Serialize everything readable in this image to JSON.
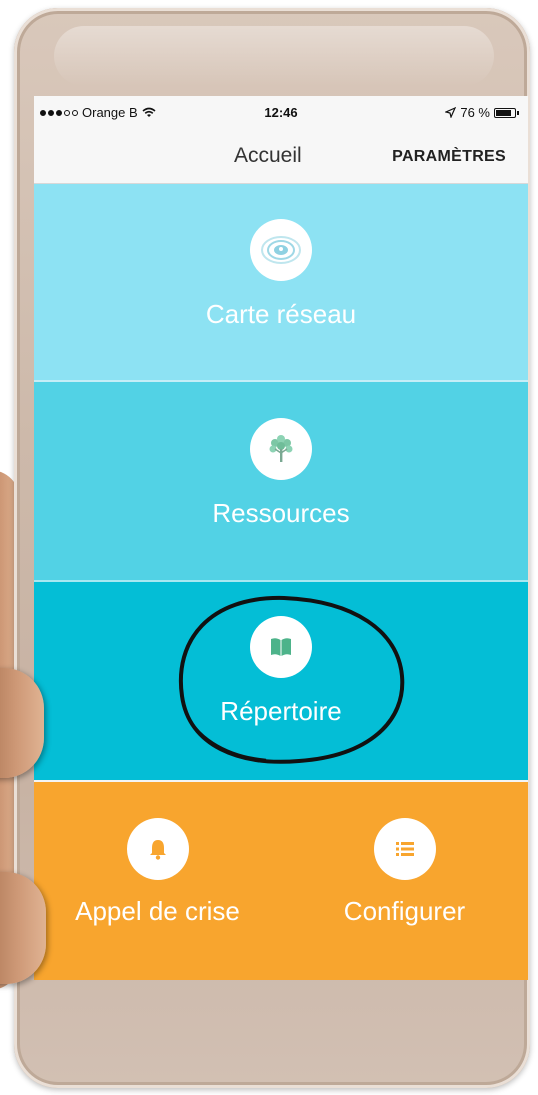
{
  "status_bar": {
    "carrier": "Orange B",
    "time": "12:46",
    "battery": "76 %"
  },
  "nav": {
    "title": "Accueil",
    "settings_label": "PARAMÈTRES"
  },
  "tiles": [
    {
      "label": "Carte réseau",
      "icon": "network-map-icon",
      "color": "#8de2f3"
    },
    {
      "label": "Ressources",
      "icon": "tree-icon",
      "color": "#52d2e5"
    },
    {
      "label": "Répertoire",
      "icon": "book-icon",
      "color": "#04bed6"
    }
  ],
  "bottom_buttons": [
    {
      "label": "Appel de crise",
      "icon": "bell-icon"
    },
    {
      "label": "Configurer",
      "icon": "list-icon"
    }
  ],
  "colors": {
    "orange": "#f8a52e",
    "icon_green": "#4db38a"
  }
}
